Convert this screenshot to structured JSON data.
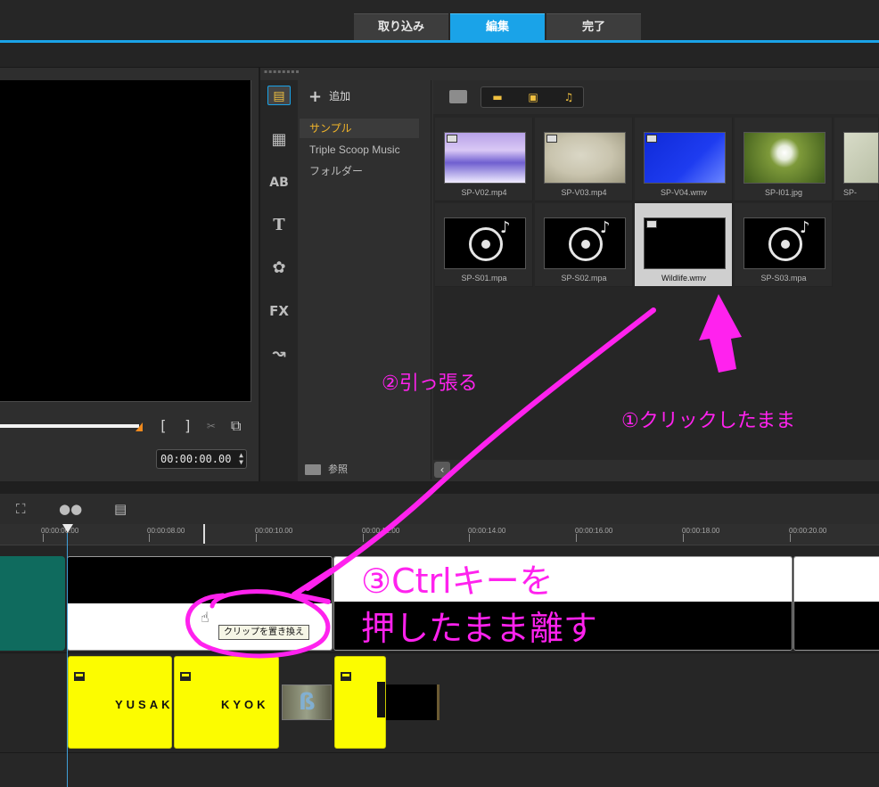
{
  "app": {
    "tabs": [
      {
        "label": "取り込み"
      },
      {
        "label": "編集"
      },
      {
        "label": "完了"
      }
    ],
    "accent": "#1aa3e8"
  },
  "preview": {
    "timecode": "00:00:00.00"
  },
  "library": {
    "add_label": "追加",
    "folders": [
      "サンプル",
      "Triple Scoop Music",
      "フォルダー"
    ],
    "browse_label": "参照",
    "media": [
      {
        "name": "SP-V02.mp4",
        "kind": "video"
      },
      {
        "name": "SP-V03.mp4",
        "kind": "video"
      },
      {
        "name": "SP-V04.wmv",
        "kind": "video"
      },
      {
        "name": "SP-I01.jpg",
        "kind": "image"
      },
      {
        "name": "SP-",
        "kind": "image"
      },
      {
        "name": "SP-S01.mpa",
        "kind": "audio"
      },
      {
        "name": "SP-S02.mpa",
        "kind": "audio"
      },
      {
        "name": "Wildlife.wmv",
        "kind": "video"
      },
      {
        "name": "SP-S03.mpa",
        "kind": "audio"
      }
    ]
  },
  "timeline": {
    "ruler": [
      "00:00:06.00",
      "00:00:08.00",
      "00:00:10.00",
      "00:00:12.00",
      "00:00:14.00",
      "00:00:16.00",
      "00:00:18.00",
      "00:00:20.00"
    ],
    "tooltip": "クリップを置き換え",
    "title_clips": [
      "YUSAK",
      "KYOK"
    ]
  },
  "annotations": {
    "step1": "①クリックしたまま",
    "step2": "②引っ張る",
    "step3_line1": "③Ctrlキーを",
    "step3_line2": "押したまま離す",
    "color": "#ff22ee"
  }
}
